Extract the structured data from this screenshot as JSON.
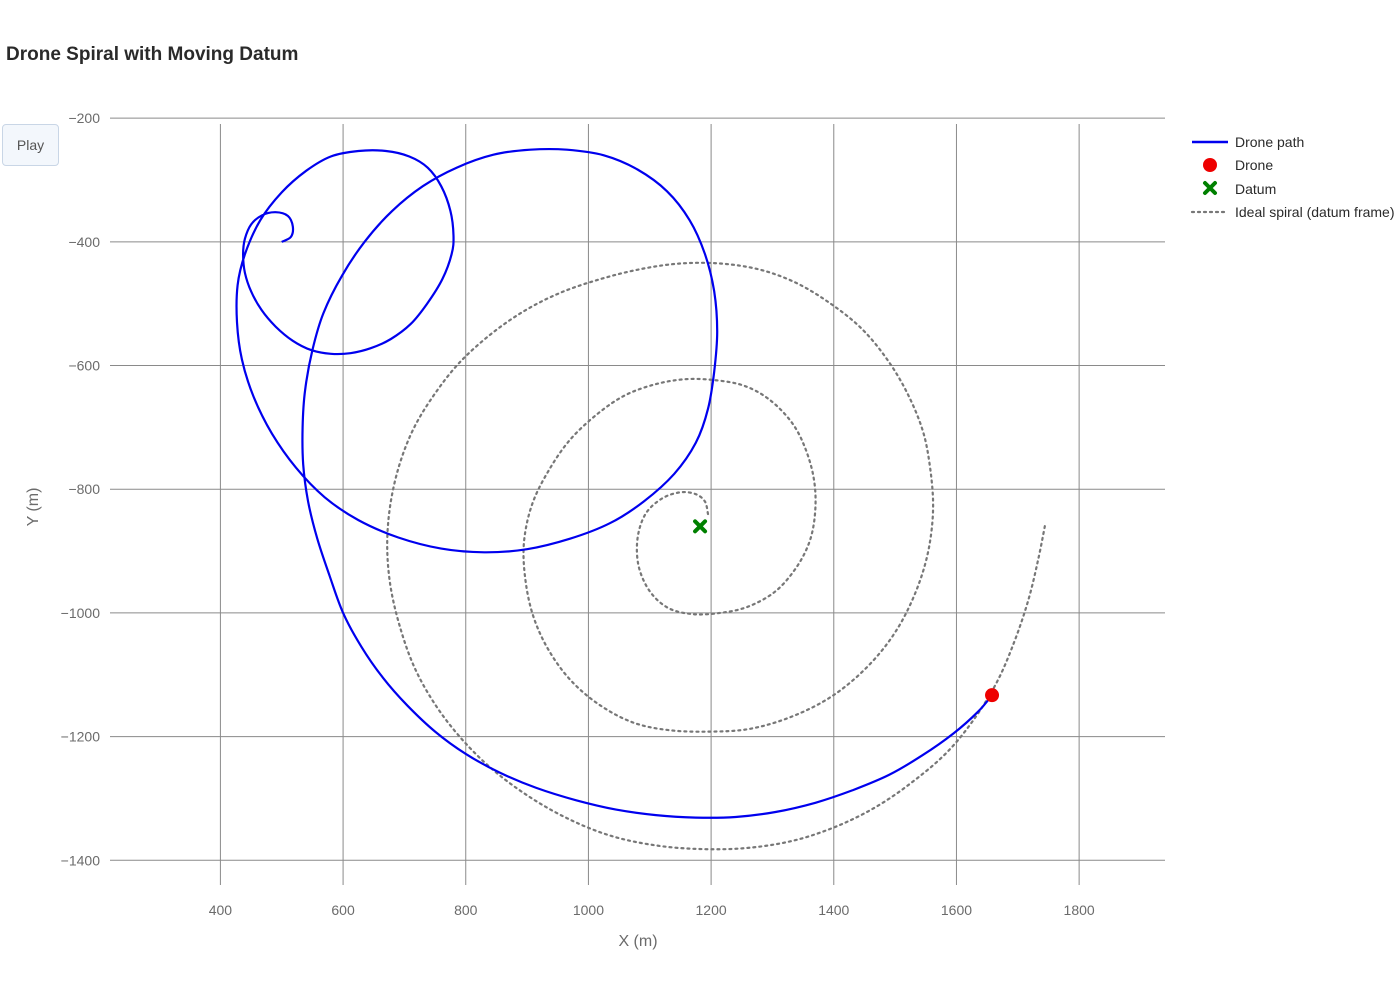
{
  "page": {
    "title": "Drone Spiral with Moving Datum",
    "play_label": "Play"
  },
  "chart_data": {
    "type": "scatter",
    "title": "Drone Spiral with Moving Datum",
    "xlabel": "X (m)",
    "ylabel": "Y (m)",
    "xlim": [
      220,
      1940
    ],
    "ylim": [
      -1440,
      -190
    ],
    "xticks": [
      400,
      600,
      800,
      1000,
      1200,
      1400,
      1600,
      1800
    ],
    "yticks": [
      -200,
      -400,
      -600,
      -800,
      -1000,
      -1200,
      -1400
    ],
    "xtick_labels": [
      "400",
      "600",
      "800",
      "1000",
      "1200",
      "1400",
      "1600",
      "1800"
    ],
    "ytick_labels": [
      "−200",
      "−400",
      "−600",
      "−800",
      "−1000",
      "−1200",
      "−1400"
    ],
    "grid": true,
    "legend_position": "right",
    "series": [
      {
        "name": "Drone path",
        "mode": "line",
        "color": "#0000ee",
        "points": [
          [
            500,
            -400
          ],
          [
            515,
            -392
          ],
          [
            518,
            -375
          ],
          [
            510,
            -358
          ],
          [
            490,
            -352
          ],
          [
            468,
            -357
          ],
          [
            450,
            -372
          ],
          [
            440,
            -395
          ],
          [
            437,
            -420
          ],
          [
            440,
            -450
          ],
          [
            450,
            -480
          ],
          [
            467,
            -510
          ],
          [
            490,
            -537
          ],
          [
            518,
            -560
          ],
          [
            548,
            -575
          ],
          [
            580,
            -581
          ],
          [
            612,
            -580
          ],
          [
            645,
            -572
          ],
          [
            678,
            -557
          ],
          [
            710,
            -533
          ],
          [
            737,
            -500
          ],
          [
            762,
            -460
          ],
          [
            777,
            -420
          ],
          [
            780,
            -390
          ],
          [
            775,
            -350
          ],
          [
            760,
            -310
          ],
          [
            738,
            -280
          ],
          [
            708,
            -262
          ],
          [
            670,
            -253
          ],
          [
            625,
            -253
          ],
          [
            580,
            -262
          ],
          [
            540,
            -285
          ],
          [
            500,
            -320
          ],
          [
            465,
            -365
          ],
          [
            440,
            -420
          ],
          [
            428,
            -470
          ],
          [
            427,
            -530
          ],
          [
            435,
            -590
          ],
          [
            454,
            -650
          ],
          [
            484,
            -710
          ],
          [
            523,
            -765
          ],
          [
            570,
            -813
          ],
          [
            625,
            -850
          ],
          [
            690,
            -878
          ],
          [
            760,
            -896
          ],
          [
            830,
            -902
          ],
          [
            900,
            -897
          ],
          [
            970,
            -880
          ],
          [
            1035,
            -855
          ],
          [
            1090,
            -820
          ],
          [
            1140,
            -775
          ],
          [
            1175,
            -725
          ],
          [
            1195,
            -670
          ],
          [
            1205,
            -610
          ],
          [
            1210,
            -545
          ],
          [
            1205,
            -480
          ],
          [
            1190,
            -420
          ],
          [
            1165,
            -365
          ],
          [
            1128,
            -318
          ],
          [
            1080,
            -283
          ],
          [
            1025,
            -260
          ],
          [
            965,
            -251
          ],
          [
            905,
            -251
          ],
          [
            845,
            -259
          ],
          [
            785,
            -280
          ],
          [
            730,
            -310
          ],
          [
            680,
            -350
          ],
          [
            635,
            -400
          ],
          [
            598,
            -455
          ],
          [
            568,
            -515
          ],
          [
            550,
            -575
          ],
          [
            538,
            -640
          ],
          [
            534,
            -700
          ],
          [
            535,
            -760
          ],
          [
            543,
            -820
          ],
          [
            558,
            -880
          ],
          [
            578,
            -940
          ],
          [
            600,
            -1000
          ],
          [
            630,
            -1055
          ],
          [
            665,
            -1105
          ],
          [
            705,
            -1150
          ],
          [
            750,
            -1192
          ],
          [
            800,
            -1228
          ],
          [
            855,
            -1258
          ],
          [
            915,
            -1283
          ],
          [
            980,
            -1303
          ],
          [
            1045,
            -1318
          ],
          [
            1110,
            -1327
          ],
          [
            1175,
            -1331
          ],
          [
            1240,
            -1330
          ],
          [
            1305,
            -1322
          ],
          [
            1370,
            -1307
          ],
          [
            1430,
            -1287
          ],
          [
            1490,
            -1262
          ],
          [
            1545,
            -1230
          ],
          [
            1595,
            -1195
          ],
          [
            1635,
            -1160
          ],
          [
            1658,
            -1133
          ]
        ]
      },
      {
        "name": "Drone",
        "mode": "marker",
        "marker": "circle",
        "color": "#ee0000",
        "points": [
          [
            1658,
            -1133
          ]
        ]
      },
      {
        "name": "Datum",
        "mode": "marker",
        "marker": "x",
        "color": "#008000",
        "points": [
          [
            1182,
            -860
          ]
        ]
      },
      {
        "name": "Ideal spiral (datum frame)",
        "mode": "line",
        "dash": "dot",
        "color": "#777777",
        "points": [
          [
            1195,
            -840
          ],
          [
            1190,
            -820
          ],
          [
            1175,
            -808
          ],
          [
            1150,
            -805
          ],
          [
            1120,
            -815
          ],
          [
            1093,
            -840
          ],
          [
            1080,
            -880
          ],
          [
            1082,
            -925
          ],
          [
            1100,
            -965
          ],
          [
            1130,
            -992
          ],
          [
            1170,
            -1002
          ],
          [
            1215,
            -1000
          ],
          [
            1260,
            -990
          ],
          [
            1305,
            -965
          ],
          [
            1340,
            -925
          ],
          [
            1362,
            -880
          ],
          [
            1370,
            -830
          ],
          [
            1367,
            -780
          ],
          [
            1352,
            -730
          ],
          [
            1330,
            -690
          ],
          [
            1295,
            -655
          ],
          [
            1255,
            -633
          ],
          [
            1210,
            -624
          ],
          [
            1160,
            -622
          ],
          [
            1110,
            -630
          ],
          [
            1060,
            -648
          ],
          [
            1015,
            -678
          ],
          [
            970,
            -720
          ],
          [
            935,
            -770
          ],
          [
            908,
            -825
          ],
          [
            895,
            -885
          ],
          [
            897,
            -945
          ],
          [
            910,
            -1005
          ],
          [
            935,
            -1060
          ],
          [
            972,
            -1110
          ],
          [
            1020,
            -1150
          ],
          [
            1075,
            -1178
          ],
          [
            1135,
            -1190
          ],
          [
            1200,
            -1192
          ],
          [
            1260,
            -1188
          ],
          [
            1320,
            -1172
          ],
          [
            1380,
            -1145
          ],
          [
            1430,
            -1110
          ],
          [
            1475,
            -1065
          ],
          [
            1510,
            -1015
          ],
          [
            1538,
            -955
          ],
          [
            1555,
            -895
          ],
          [
            1562,
            -830
          ],
          [
            1557,
            -765
          ],
          [
            1545,
            -705
          ],
          [
            1520,
            -645
          ],
          [
            1487,
            -590
          ],
          [
            1445,
            -540
          ],
          [
            1395,
            -500
          ],
          [
            1340,
            -467
          ],
          [
            1280,
            -445
          ],
          [
            1215,
            -435
          ],
          [
            1150,
            -435
          ],
          [
            1085,
            -444
          ],
          [
            1020,
            -460
          ],
          [
            955,
            -482
          ],
          [
            895,
            -512
          ],
          [
            840,
            -550
          ],
          [
            790,
            -595
          ],
          [
            750,
            -645
          ],
          [
            716,
            -700
          ],
          [
            692,
            -760
          ],
          [
            677,
            -825
          ],
          [
            672,
            -890
          ],
          [
            677,
            -955
          ],
          [
            692,
            -1020
          ],
          [
            715,
            -1085
          ],
          [
            748,
            -1145
          ],
          [
            790,
            -1200
          ],
          [
            840,
            -1250
          ],
          [
            900,
            -1295
          ],
          [
            965,
            -1332
          ],
          [
            1035,
            -1360
          ],
          [
            1110,
            -1376
          ],
          [
            1185,
            -1382
          ],
          [
            1260,
            -1380
          ],
          [
            1335,
            -1368
          ],
          [
            1405,
            -1345
          ],
          [
            1470,
            -1313
          ],
          [
            1530,
            -1272
          ],
          [
            1585,
            -1225
          ],
          [
            1630,
            -1170
          ],
          [
            1667,
            -1110
          ],
          [
            1695,
            -1045
          ],
          [
            1717,
            -980
          ],
          [
            1733,
            -915
          ],
          [
            1745,
            -855
          ]
        ]
      }
    ]
  }
}
